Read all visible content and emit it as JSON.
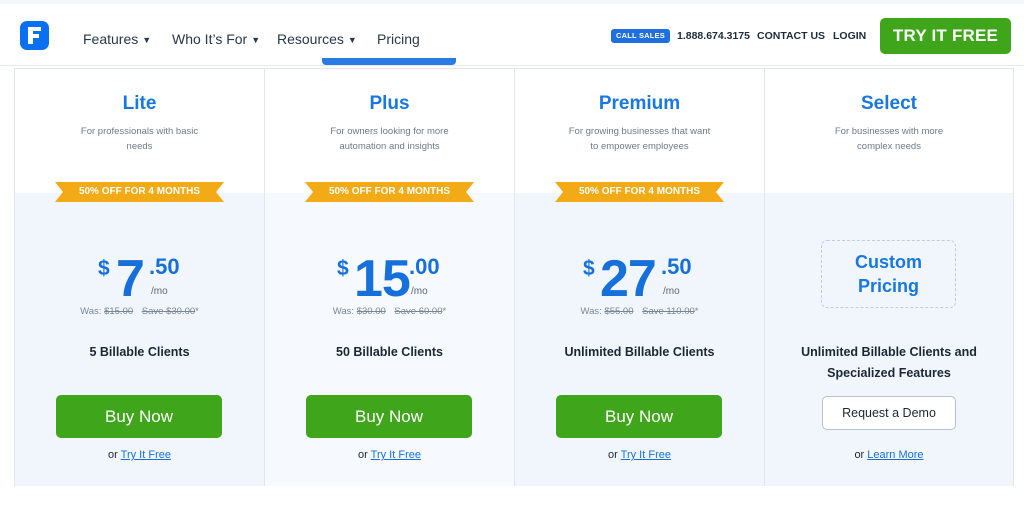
{
  "nav": {
    "items": [
      {
        "label": "Features",
        "has_dropdown": true
      },
      {
        "label": "Who It’s For",
        "has_dropdown": true
      },
      {
        "label": "Resources",
        "has_dropdown": true
      },
      {
        "label": "Pricing",
        "has_dropdown": false
      }
    ],
    "call_sales": "CALL SALES",
    "phone": "1.888.674.3175",
    "contact": "CONTACT US",
    "login": "LOGIN",
    "try_free": "TRY IT FREE",
    "logo_letter": "F",
    "logo_icon": "freshbooks-logo-icon"
  },
  "colors": {
    "brand_blue": "#1877e0",
    "green": "#3fa51a",
    "ribbon": "#f2aa16"
  },
  "plans": [
    {
      "name": "Lite",
      "description": "For professionals with basic needs",
      "ribbon": "50% OFF FOR 4 MONTHS",
      "currency": "$",
      "dollars": "7",
      "cents": ".50",
      "period": "/mo",
      "was_label": "Was:",
      "was_price": "$15.00",
      "save": "Save $30.00",
      "asterisk": "*",
      "clients": "5 Billable Clients",
      "cta": "Buy Now",
      "or": "or",
      "link": "Try It Free"
    },
    {
      "name": "Plus",
      "description": "For owners looking for more automation and insights",
      "ribbon": "50% OFF FOR 4 MONTHS",
      "currency": "$",
      "dollars": "15",
      "cents": ".00",
      "period": "/mo",
      "was_label": "Was:",
      "was_price": "$30.00",
      "save": "Save 60.00",
      "asterisk": "*",
      "clients": "50 Billable Clients",
      "cta": "Buy Now",
      "or": "or",
      "link": "Try It Free"
    },
    {
      "name": "Premium",
      "description": "For growing businesses that want to empower employees",
      "ribbon": "50% OFF FOR 4 MONTHS",
      "currency": "$",
      "dollars": "27",
      "cents": ".50",
      "period": "/mo",
      "was_label": "Was:",
      "was_price": "$55.00",
      "save": "Save 110.00",
      "asterisk": "*",
      "clients": "Unlimited Billable Clients",
      "cta": "Buy Now",
      "or": "or",
      "link": "Try It Free"
    },
    {
      "name": "Select",
      "description": "For businesses with more complex needs",
      "custom_line1": "Custom",
      "custom_line2": "Pricing",
      "clients": "Unlimited Billable Clients and Specialized Features",
      "cta": "Request a Demo",
      "or": "or",
      "link": "Learn More"
    }
  ]
}
